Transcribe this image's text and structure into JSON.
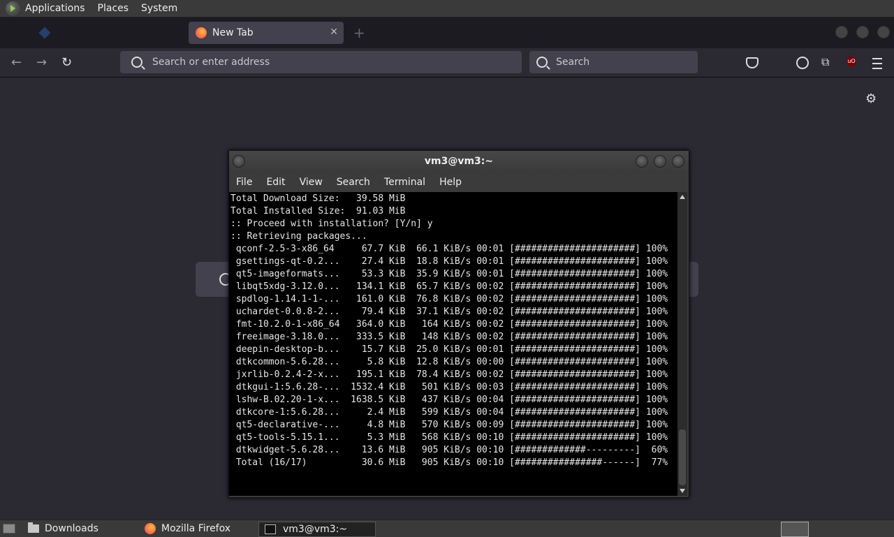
{
  "top_panel": {
    "menus": [
      "Applications",
      "Places",
      "System"
    ]
  },
  "browser": {
    "active_tab_title": "New Tab",
    "url_placeholder": "Search or enter address",
    "search_placeholder": "Search",
    "ublock_badge": "uO"
  },
  "terminal": {
    "title": "vm3@vm3:~",
    "menu": [
      "File",
      "Edit",
      "View",
      "Search",
      "Terminal",
      "Help"
    ],
    "lines": [
      "Total Download Size:   39.58 MiB",
      "Total Installed Size:  91.03 MiB",
      "",
      ":: Proceed with installation? [Y/n] y",
      ":: Retrieving packages...",
      " qconf-2.5-3-x86_64     67.7 KiB  66.1 KiB/s 00:01 [######################] 100%",
      " gsettings-qt-0.2...    27.4 KiB  18.8 KiB/s 00:01 [######################] 100%",
      " qt5-imageformats...    53.3 KiB  35.9 KiB/s 00:01 [######################] 100%",
      " libqt5xdg-3.12.0...   134.1 KiB  65.7 KiB/s 00:02 [######################] 100%",
      " spdlog-1.14.1-1-...   161.0 KiB  76.8 KiB/s 00:02 [######################] 100%",
      " uchardet-0.0.8-2...    79.4 KiB  37.1 KiB/s 00:02 [######################] 100%",
      " fmt-10.2.0-1-x86_64   364.0 KiB   164 KiB/s 00:02 [######################] 100%",
      " freeimage-3.18.0...   333.5 KiB   148 KiB/s 00:02 [######################] 100%",
      " deepin-desktop-b...    15.7 KiB  25.0 KiB/s 00:01 [######################] 100%",
      " dtkcommon-5.6.28...     5.8 KiB  12.8 KiB/s 00:00 [######################] 100%",
      " jxrlib-0.2.4-2-x...   195.1 KiB  78.4 KiB/s 00:02 [######################] 100%",
      " dtkgui-1:5.6.28-...  1532.4 KiB   501 KiB/s 00:03 [######################] 100%",
      " lshw-B.02.20-1-x...  1638.5 KiB   437 KiB/s 00:04 [######################] 100%",
      " dtkcore-1:5.6.28...     2.4 MiB   599 KiB/s 00:04 [######################] 100%",
      " qt5-declarative-...     4.8 MiB   570 KiB/s 00:09 [######################] 100%",
      " qt5-tools-5.15.1...     5.3 MiB   568 KiB/s 00:10 [######################] 100%",
      " dtkwidget-5.6.28...    13.6 MiB   905 KiB/s 00:10 [#############---------]  60%",
      " Total (16/17)          30.6 MiB   905 KiB/s 00:10 [################------]  77%"
    ]
  },
  "taskbar": {
    "items": [
      "Downloads",
      "Mozilla Firefox",
      "vm3@vm3:~"
    ]
  }
}
